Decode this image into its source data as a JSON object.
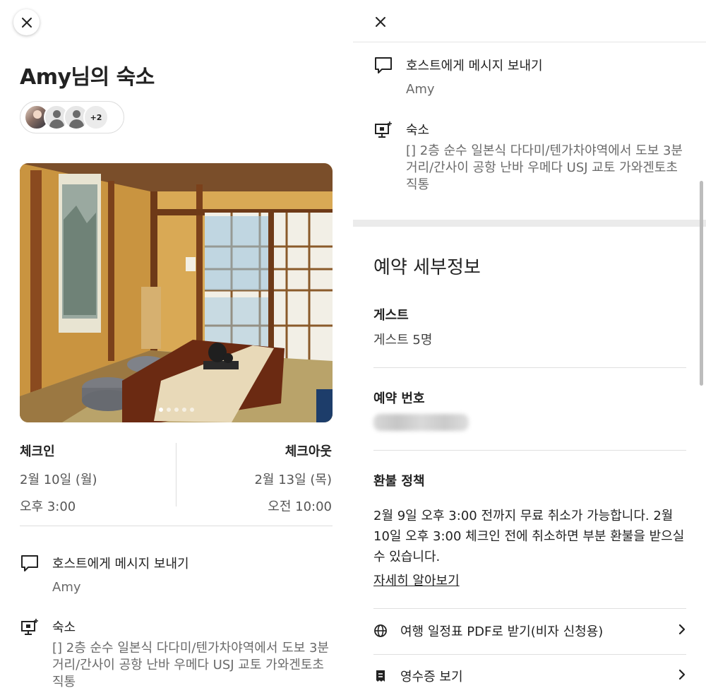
{
  "left": {
    "title": "Amy님의 숙소",
    "extra_guests": "+2",
    "carousel": {
      "total": 5,
      "active": 0
    },
    "checkin": {
      "label": "체크인",
      "date": "2월 10일 (월)",
      "time": "오후 3:00"
    },
    "checkout": {
      "label": "체크아웃",
      "date": "2월 13일 (목)",
      "time": "오전 10:00"
    },
    "message_host": {
      "label": "호스트에게 메시지 보내기",
      "name": "Amy"
    },
    "listing": {
      "label": "숙소",
      "line1": "[] 2층 순수 일본식 다다미/텐가차야역에서 도보 3분",
      "line2": "거리/간사이 공항 난바 우메다 USJ 교토 가와겐토초",
      "line3": "직통"
    }
  },
  "right": {
    "message_host": {
      "label": "호스트에게 메시지 보내기",
      "name": "Amy"
    },
    "listing": {
      "label": "숙소",
      "line1": "[] 2층 순수 일본식 다다미/텐가차야역에서 도보 3분",
      "line2": "거리/간사이 공항 난바 우메다 USJ 교토 가와겐토초",
      "line3": "직통"
    },
    "section_title": "예약 세부정보",
    "guests": {
      "label": "게스트",
      "value": "게스트 5명"
    },
    "reservation": {
      "label": "예약 번호"
    },
    "refund": {
      "label": "환불 정책",
      "line1": "2월 9일 오후 3:00 전까지 무료 취소가 가능합니다. 2월",
      "line2": "10일 오후 3:00 체크인 전에 취소하면 부분 환불을 받으실",
      "line3": "수 있습니다.",
      "learn_more": "자세히 알아보기"
    },
    "links": [
      {
        "label": "여행 일정표 PDF로 받기(비자 신청용)",
        "icon": "globe-icon"
      },
      {
        "label": "영수증 보기",
        "icon": "receipt-icon"
      }
    ]
  }
}
